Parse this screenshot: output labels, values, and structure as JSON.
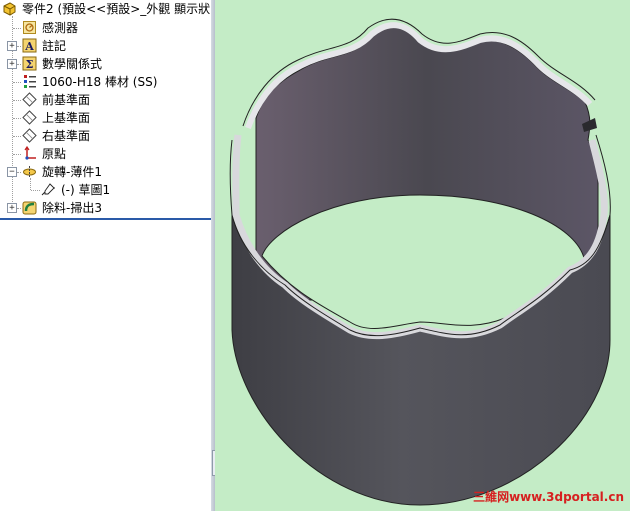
{
  "feature_tree": {
    "root": "零件2  (預設<<預設>_外觀 顯示狀",
    "items": [
      {
        "label": "感測器",
        "icon": "sensor-icon"
      },
      {
        "label": "註記",
        "icon": "annotations-icon"
      },
      {
        "label": "數學關係式",
        "icon": "equations-icon"
      },
      {
        "label": "1060-H18 棒材 (SS)",
        "icon": "material-icon"
      },
      {
        "label": "前基準面",
        "icon": "plane-icon"
      },
      {
        "label": "上基準面",
        "icon": "plane-icon"
      },
      {
        "label": "右基準面",
        "icon": "plane-icon"
      },
      {
        "label": "原點",
        "icon": "origin-icon"
      },
      {
        "label": "旋轉-薄件1",
        "icon": "revolve-thin-icon"
      },
      {
        "label": "(-) 草圖1",
        "icon": "sketch-icon"
      },
      {
        "label": "除料-掃出3",
        "icon": "swept-cut-icon"
      }
    ]
  },
  "watermark": "三維网www.3dportal.cn",
  "colors": {
    "viewport_bg": "#c4ecc6",
    "part_body": "#4f4f57",
    "part_inner": "#5a5060",
    "rollback_bar": "#2a5aa8",
    "watermark": "#d62020"
  }
}
